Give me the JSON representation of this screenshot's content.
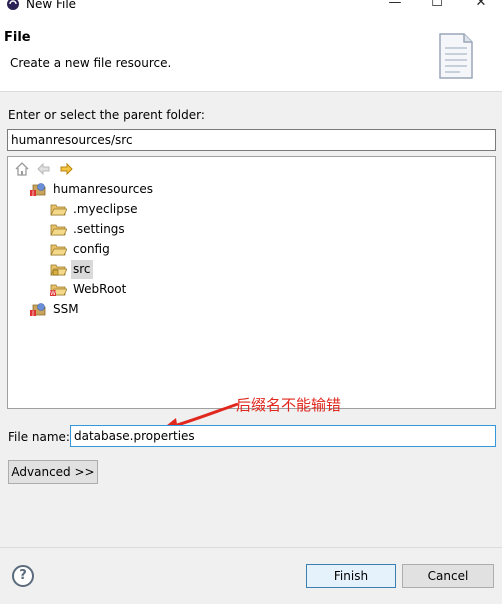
{
  "window": {
    "title": "New File",
    "minimize_glyph": "—",
    "maximize_glyph": "☐",
    "close_glyph": "✕"
  },
  "header": {
    "title": "File",
    "description": "Create a new file resource.",
    "icon": "file-document-icon"
  },
  "parent_folder": {
    "label": "Enter or select the parent folder:",
    "value": "humanresources/src"
  },
  "tree": {
    "toolbar": [
      "home-icon",
      "back-arrow-icon",
      "forward-arrow-icon"
    ],
    "items": [
      {
        "label": "humanresources",
        "icon": "project-icon",
        "level": 0,
        "selected": false
      },
      {
        "label": ".myeclipse",
        "icon": "folder-icon",
        "level": 1,
        "selected": false
      },
      {
        "label": ".settings",
        "icon": "folder-icon",
        "level": 1,
        "selected": false
      },
      {
        "label": "config",
        "icon": "folder-icon",
        "level": 1,
        "selected": false
      },
      {
        "label": "src",
        "icon": "source-folder-icon",
        "level": 1,
        "selected": true
      },
      {
        "label": "WebRoot",
        "icon": "web-folder-icon",
        "level": 1,
        "selected": false
      },
      {
        "label": "SSM",
        "icon": "project-icon",
        "level": 0,
        "selected": false
      }
    ]
  },
  "annotation": {
    "text": "后缀名不能输错",
    "color": "#e0281e"
  },
  "file_name": {
    "label": "File name:",
    "value": "database.properties"
  },
  "buttons": {
    "advanced": "Advanced >>",
    "help": "?",
    "finish": "Finish",
    "cancel": "Cancel"
  }
}
